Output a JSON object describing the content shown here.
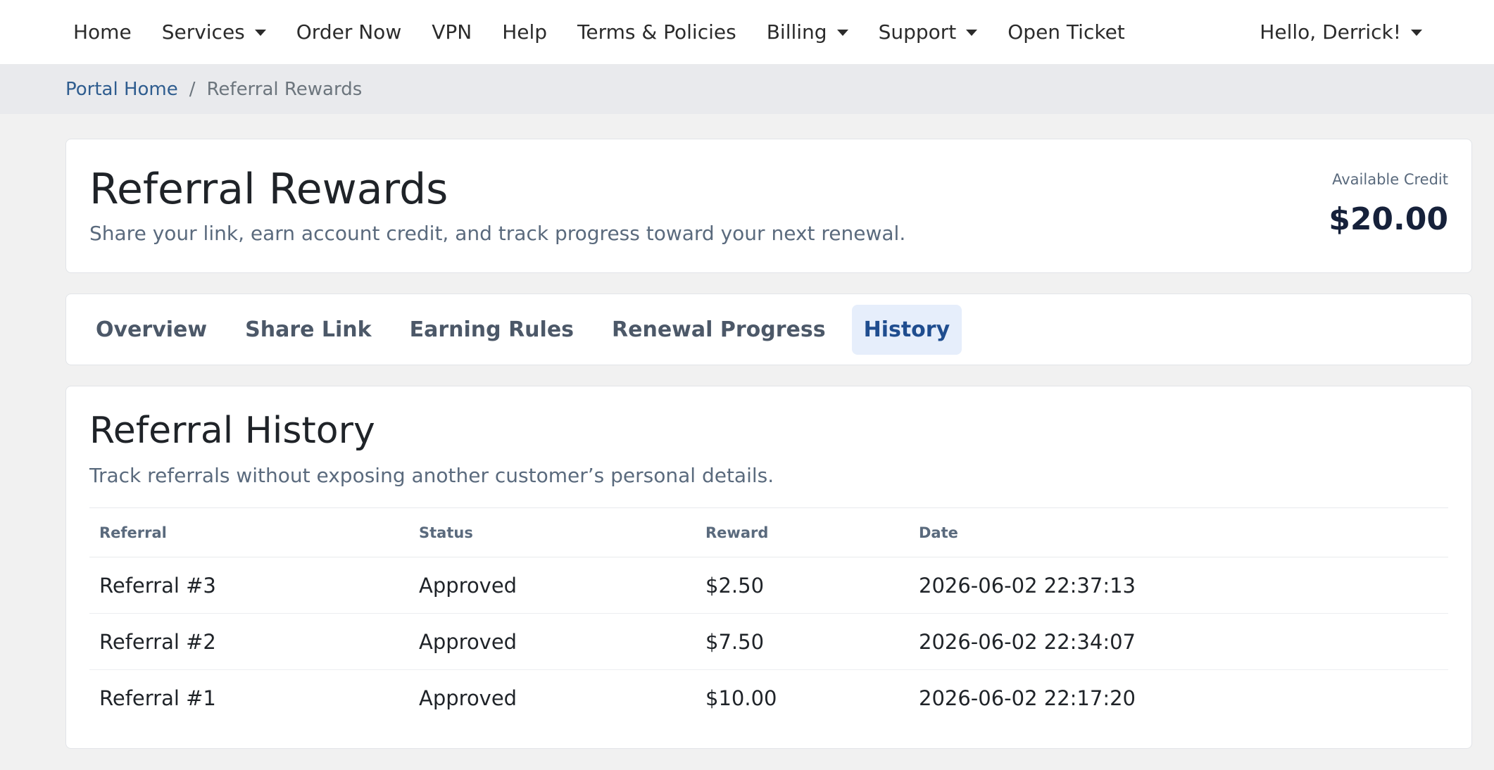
{
  "nav": {
    "items": [
      {
        "label": "Home",
        "dropdown": false
      },
      {
        "label": "Services",
        "dropdown": true
      },
      {
        "label": "Order Now",
        "dropdown": false
      },
      {
        "label": "VPN",
        "dropdown": false
      },
      {
        "label": "Help",
        "dropdown": false
      },
      {
        "label": "Terms & Policies",
        "dropdown": false
      },
      {
        "label": "Billing",
        "dropdown": true
      },
      {
        "label": "Support",
        "dropdown": true
      },
      {
        "label": "Open Ticket",
        "dropdown": false
      }
    ],
    "user_menu": "Hello, Derrick!"
  },
  "breadcrumb": {
    "home": "Portal Home",
    "separator": "/",
    "current": "Referral Rewards"
  },
  "header": {
    "title": "Referral Rewards",
    "subtitle": "Share your link, earn account credit, and track progress toward your next renewal.",
    "credit_label": "Available Credit",
    "credit_amount": "$20.00"
  },
  "tabs": [
    {
      "label": "Overview",
      "active": false
    },
    {
      "label": "Share Link",
      "active": false
    },
    {
      "label": "Earning Rules",
      "active": false
    },
    {
      "label": "Renewal Progress",
      "active": false
    },
    {
      "label": "History",
      "active": true
    }
  ],
  "history": {
    "title": "Referral History",
    "subtitle": "Track referrals without exposing another customer’s personal details.",
    "columns": [
      "Referral",
      "Status",
      "Reward",
      "Date"
    ],
    "rows": [
      [
        "Referral #3",
        "Approved",
        "$2.50",
        "2026-06-02 22:37:13"
      ],
      [
        "Referral #2",
        "Approved",
        "$7.50",
        "2026-06-02 22:34:07"
      ],
      [
        "Referral #1",
        "Approved",
        "$10.00",
        "2026-06-02 22:17:20"
      ]
    ]
  },
  "colors": {
    "link": "#2f5d8f",
    "active_tab_bg": "#e6eefb",
    "active_tab_text": "#1f4d8f",
    "breadcrumb_bg": "#e9eaed",
    "page_bg": "#f1f1f1"
  }
}
